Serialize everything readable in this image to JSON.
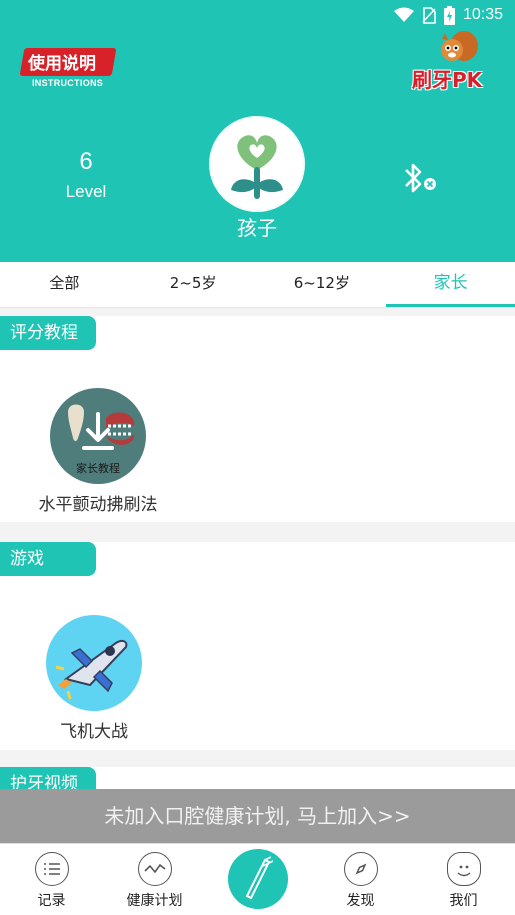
{
  "status_bar": {
    "time": "10:35"
  },
  "header": {
    "logo_left_text": "使用说明",
    "logo_left_sub": "INSTRUCTIONS",
    "logo_right_text": "刷牙PK",
    "level_value": "6",
    "level_label": "Level",
    "child_name": "孩子"
  },
  "tabs": [
    {
      "label": "全部"
    },
    {
      "label": "2~5岁"
    },
    {
      "label": "6~12岁"
    },
    {
      "label": "家长",
      "active": true
    }
  ],
  "sections": [
    {
      "title": "评分教程",
      "items": [
        {
          "caption": "水平颤动拂刷法",
          "badge": "家长教程"
        }
      ]
    },
    {
      "title": "游戏",
      "items": [
        {
          "caption": "飞机大战"
        }
      ]
    },
    {
      "title": "护牙视频"
    }
  ],
  "join_banner": "未加入口腔健康计划, 马上加入>>",
  "bottom_nav": {
    "records": "记录",
    "health_plan": "健康计划",
    "discover": "发现",
    "us": "我们"
  },
  "colors": {
    "accent": "#1fc4b4",
    "brand_red": "#d8222a"
  }
}
